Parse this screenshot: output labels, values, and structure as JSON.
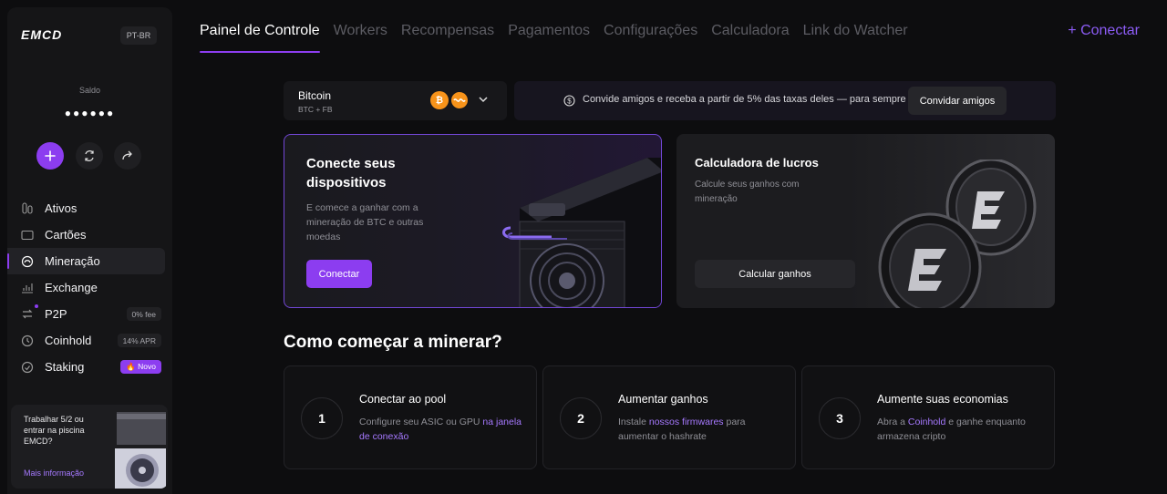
{
  "sidebar": {
    "logo": "EMCD",
    "lang": "PT-BR",
    "balance_label": "Saldo",
    "balance_value": "●●●●●●",
    "items": [
      {
        "label": "Ativos",
        "icon": "assets-icon"
      },
      {
        "label": "Cartões",
        "icon": "card-icon"
      },
      {
        "label": "Mineração",
        "icon": "mining-icon",
        "active": true
      },
      {
        "label": "Exchange",
        "icon": "exchange-icon"
      },
      {
        "label": "P2P",
        "icon": "p2p-icon",
        "badge": "0% fee"
      },
      {
        "label": "Coinhold",
        "icon": "coinhold-icon",
        "badge": "14% APR"
      },
      {
        "label": "Staking",
        "icon": "staking-icon",
        "badge": "🔥 Novo"
      }
    ],
    "promo": {
      "text": "Trabalhar 5/2 ou entrar na piscina EMCD?",
      "link": "Mais informação"
    }
  },
  "tabs": [
    "Painel de Controle",
    "Workers",
    "Recompensas",
    "Pagamentos",
    "Configurações",
    "Calculadora",
    "Link do Watcher"
  ],
  "connect_top": "+ Conectar",
  "coin_selector": {
    "name": "Bitcoin",
    "sub": "BTC + FB"
  },
  "referral": {
    "text": "Convide amigos e receba a partir de 5% das taxas deles — para sempre",
    "button": "Convidar amigos"
  },
  "connect_card": {
    "title": "Conecte seus dispositivos",
    "desc": "E comece a ganhar com a mineração de BTC e outras moedas",
    "button": "Conectar"
  },
  "calc_card": {
    "title": "Calculadora de lucros",
    "desc": "Calcule seus ganhos com mineração",
    "button": "Calcular ganhos"
  },
  "how_to": {
    "title": "Como começar a minerar?",
    "steps": [
      {
        "num": "1",
        "title": "Conectar ao pool",
        "desc_a": "Configure seu ASIC ou GPU ",
        "link": "na janela de conexão",
        "desc_b": ""
      },
      {
        "num": "2",
        "title": "Aumentar ganhos",
        "desc_a": "Instale ",
        "link": "nossos firmwares",
        "desc_b": " para aumentar o hashrate"
      },
      {
        "num": "3",
        "title": "Aumente suas economias",
        "desc_a": "Abra a ",
        "link": "Coinhold",
        "desc_b": " e ganhe enquanto armazena cripto"
      }
    ]
  },
  "colors": {
    "accent": "#8c3df0",
    "link": "#a679ff",
    "btc": "#f7931a"
  }
}
